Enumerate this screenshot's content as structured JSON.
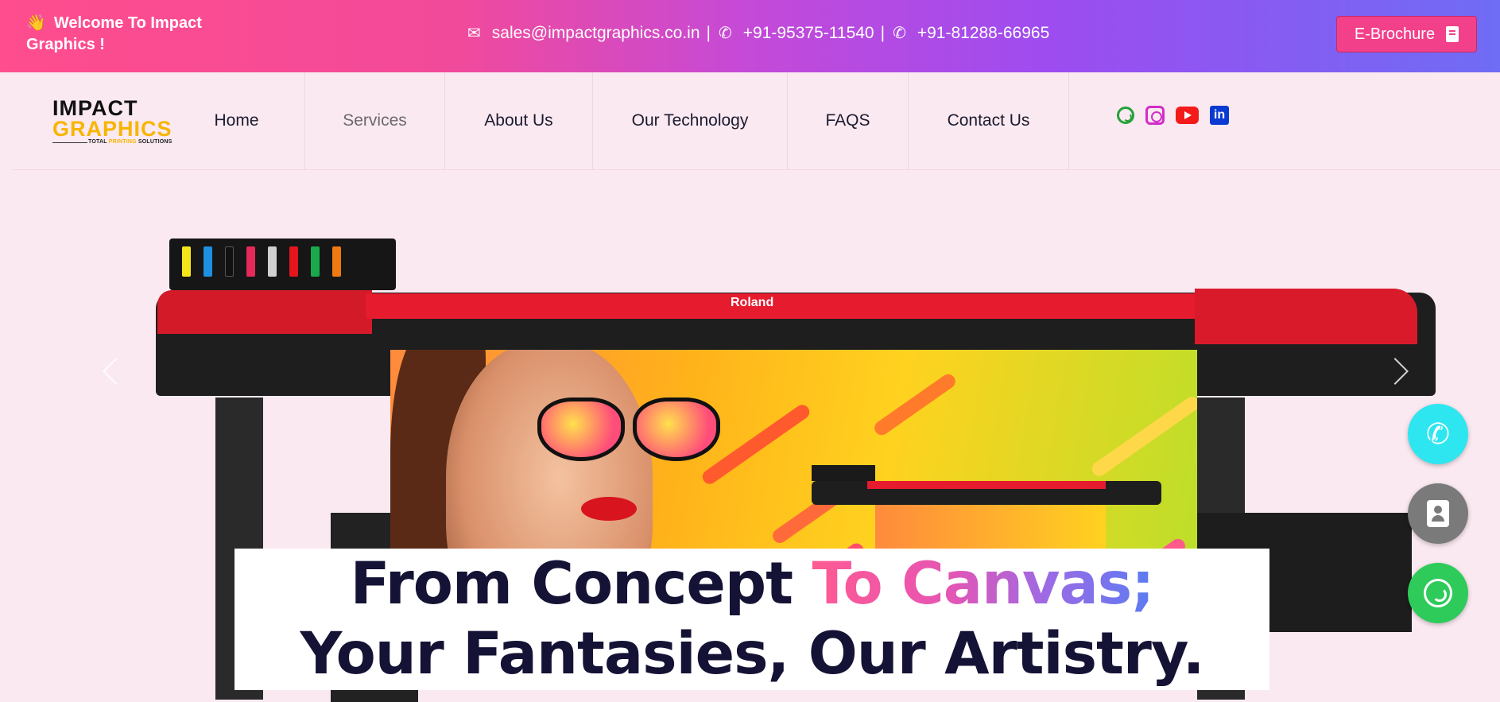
{
  "topbar": {
    "welcome_emoji": "👋",
    "welcome_text": "Welcome To Impact Graphics !",
    "email": "sales@impactgraphics.co.in",
    "separator": "|",
    "phone1": "+91-95375-11540",
    "phone2": "+91-81288-66965",
    "ebrochure_label": "E-Brochure"
  },
  "logo": {
    "line1": "IMPACT",
    "line2": "GRAPHICS",
    "tagline_pre": "TOTAL",
    "tagline_gold": "PRINTING",
    "tagline_post": "SOLUTIONS"
  },
  "nav": {
    "items": [
      {
        "label": "Home"
      },
      {
        "label": "Services"
      },
      {
        "label": "About Us"
      },
      {
        "label": "Our Technology"
      },
      {
        "label": "FAQS"
      },
      {
        "label": "Contact Us"
      }
    ],
    "social": [
      "whatsapp-icon",
      "instagram-icon",
      "youtube-icon",
      "linkedin-icon"
    ],
    "linkedin_glyph": "in"
  },
  "hero": {
    "printer_brand": "Roland",
    "headline_line1_dark": "From Concept ",
    "headline_line1_gradient": "To Canvas;",
    "headline_line2": "Your Fantasies, Our Artistry."
  },
  "colors": {
    "accent_pink": "#ff4d8d",
    "accent_purple": "#9d4cf0",
    "accent_blue": "#6f6cf5",
    "headline_dark": "#141335",
    "call_button": "#2ee6f0",
    "whatsapp_button": "#2ecb5a"
  },
  "floating_buttons": [
    "phone-icon",
    "contact-card-icon",
    "whatsapp-icon"
  ]
}
